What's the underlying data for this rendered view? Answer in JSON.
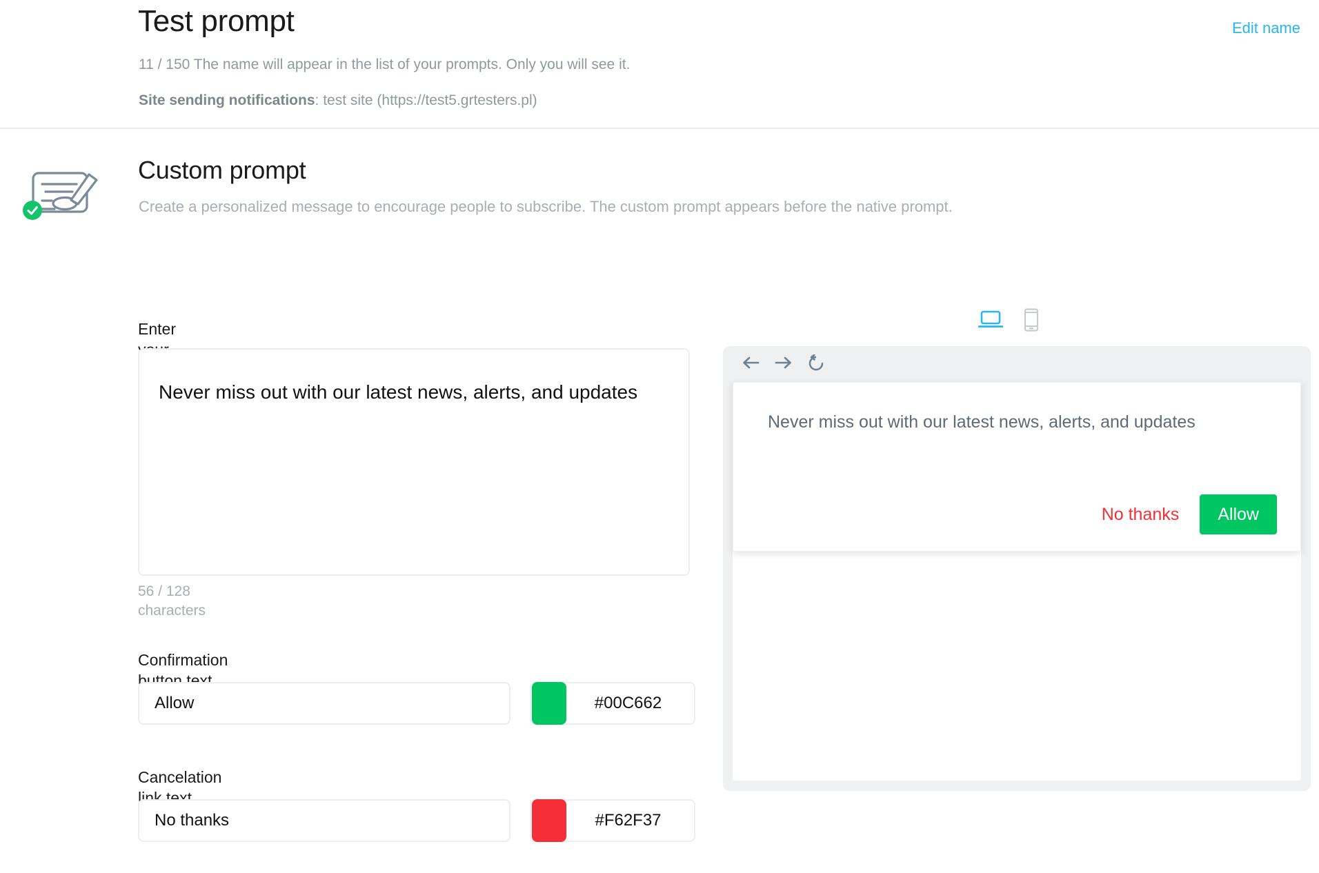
{
  "header": {
    "title": "Test prompt",
    "edit_name_label": "Edit name",
    "name_counter_text": "11 / 150 The name will appear in the list of your prompts. Only you will see it.",
    "site_label": "Site sending notifications",
    "site_value": ": test site (https://test5.grtesters.pl)"
  },
  "section": {
    "icon": "prompt-brush-icon",
    "badge_icon": "check-circle-icon",
    "title": "Custom prompt",
    "description": "Create a personalized message to encourage people to subscribe. The custom prompt appears before the native prompt."
  },
  "form": {
    "prompt_label": "Enter your prompt message",
    "prompt_value": "Never miss out with our latest news, alerts, and updates",
    "prompt_placeholder": "Enter your prompt message",
    "char_counter": "56 / 128 characters",
    "confirm_label": "Confirmation button text and color:",
    "confirm_value": "Allow",
    "confirm_placeholder": "Allow",
    "confirm_color": "#00C662",
    "cancel_label": "Cancelation link text and color:",
    "cancel_value": "No thanks",
    "cancel_placeholder": "No thanks",
    "cancel_color": "#F62F37"
  },
  "preview": {
    "devices": [
      {
        "name": "desktop-preview-toggle",
        "icon": "laptop-icon",
        "active": true
      },
      {
        "name": "mobile-preview-toggle",
        "icon": "mobile-icon",
        "active": false
      }
    ],
    "browser_nav": [
      {
        "name": "back-icon",
        "glyph": "←"
      },
      {
        "name": "forward-icon",
        "glyph": "→"
      },
      {
        "name": "reload-icon",
        "glyph": "↺"
      }
    ],
    "prompt_message": "Never miss out with our latest news, alerts, and updates",
    "cancel_text": "No thanks",
    "allow_text": "Allow"
  },
  "colors": {
    "accent_link": "#29b6f0",
    "confirm_green": "#00C662",
    "cancel_red": "#F62F37",
    "muted_text": "#a9aeb5",
    "border": "#eceef0"
  }
}
